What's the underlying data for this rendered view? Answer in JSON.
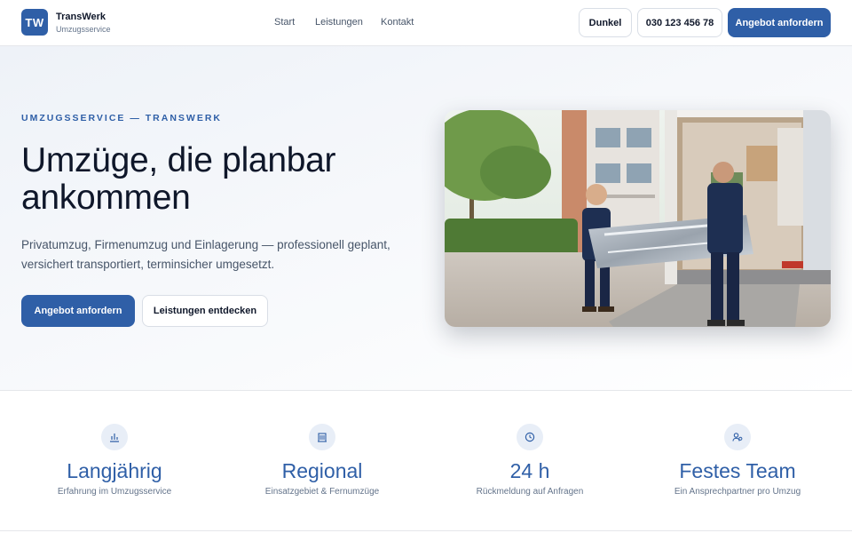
{
  "header": {
    "logo_initials": "TW",
    "brand_name": "TransWerk",
    "brand_sub": "Umzugsservice",
    "nav": [
      "Start",
      "Leistungen",
      "Kontakt"
    ],
    "theme_toggle": "Dunkel",
    "phone": "030 123 456 78",
    "cta": "Angebot anfordern"
  },
  "hero": {
    "eyebrow": "UMZUGSSERVICE — TRANSWERK",
    "title": "Umzüge, die planbar ankommen",
    "text": "Privatumzug, Firmenumzug und Einlagerung — professionell geplant, versichert transportiert, terminsicher umgesetzt.",
    "cta_primary": "Angebot anfordern",
    "cta_secondary": "Leistungen entdecken"
  },
  "stats": [
    {
      "icon": "bar-chart-icon",
      "value": "Langjährig",
      "label": "Erfahrung im Umzugsservice"
    },
    {
      "icon": "building-icon",
      "value": "Regional",
      "label": "Einsatzgebiet & Fernumzüge"
    },
    {
      "icon": "clock-icon",
      "value": "24 h",
      "label": "Rückmeldung auf Anfragen"
    },
    {
      "icon": "user-check-icon",
      "value": "Festes Team",
      "label": "Ein Ansprechpartner pro Umzug"
    }
  ],
  "colors": {
    "accent": "#2f5fa7",
    "text": "#0f172a",
    "muted": "#64748b"
  }
}
